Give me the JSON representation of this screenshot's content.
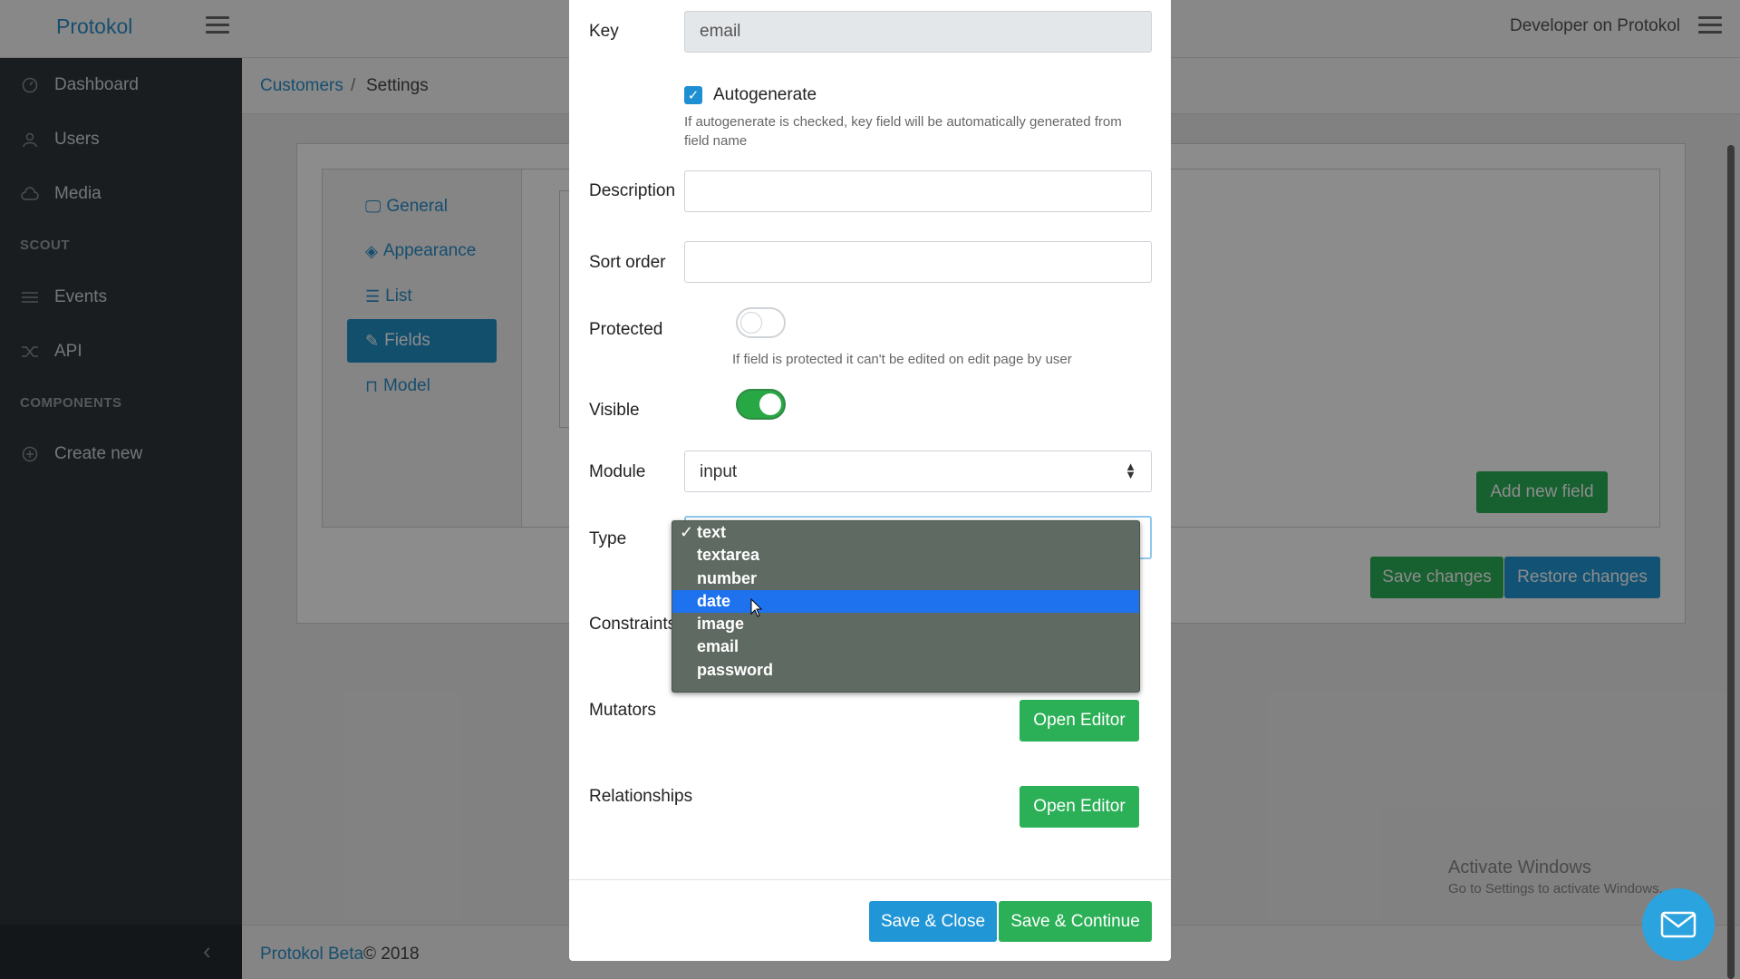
{
  "app": {
    "brand": "Protokol",
    "user": "Developer on Protokol"
  },
  "sidebar": {
    "items": [
      {
        "label": "Dashboard",
        "icon": "speedometer-icon"
      },
      {
        "label": "Users",
        "icon": "user-icon"
      },
      {
        "label": "Media",
        "icon": "cloud-icon"
      }
    ],
    "section_scout": "SCOUT",
    "scout_items": [
      {
        "label": "Events",
        "icon": "list-icon"
      },
      {
        "label": "API",
        "icon": "shuffle-icon"
      }
    ],
    "section_components": "COMPONENTS",
    "components_items": [
      {
        "label": "Create new",
        "icon": "plus-circle-icon"
      }
    ]
  },
  "breadcrumb": {
    "link": "Customers",
    "separator": "/",
    "current": "Settings"
  },
  "settings_tabs": [
    {
      "label": "General",
      "icon": "monitor-icon"
    },
    {
      "label": "Appearance",
      "icon": "layers-icon"
    },
    {
      "label": "List",
      "icon": "list-icon"
    },
    {
      "label": "Fields",
      "icon": "pencil-icon",
      "active": true
    },
    {
      "label": "Model",
      "icon": "model-icon"
    }
  ],
  "page_buttons": {
    "add_new_field": "Add new field",
    "save_changes": "Save changes",
    "restore_changes": "Restore changes"
  },
  "footer": {
    "link": "Protokol Beta",
    "copyright": "© 2018"
  },
  "watermark": {
    "line1": "Activate Windows",
    "line2": "Go to Settings to activate Windows."
  },
  "modal": {
    "key": {
      "label": "Key",
      "value": "email"
    },
    "autogenerate": {
      "label": "Autogenerate",
      "checked": true,
      "help": "If autogenerate is checked, key field will be automatically generated from field name"
    },
    "description": {
      "label": "Description",
      "value": ""
    },
    "sort_order": {
      "label": "Sort order",
      "value": ""
    },
    "protected": {
      "label": "Protected",
      "on": false,
      "help": "If field is protected it can't be edited on edit page by user"
    },
    "visible": {
      "label": "Visible",
      "on": true
    },
    "module": {
      "label": "Module",
      "value": "input"
    },
    "type": {
      "label": "Type",
      "options": [
        "text",
        "textarea",
        "number",
        "date",
        "image",
        "email",
        "password"
      ],
      "checked": "text",
      "highlighted": "date"
    },
    "constraints": {
      "label": "Constraints"
    },
    "mutators": {
      "label": "Mutators",
      "button": "Open Editor"
    },
    "relationships": {
      "label": "Relationships",
      "button": "Open Editor"
    },
    "save_close": "Save & Close",
    "save_continue": "Save & Continue"
  },
  "colors": {
    "brand_blue": "#2a8fc9",
    "green": "#2bb057",
    "blue_button": "#2196d6",
    "dropdown_highlight": "#1f72ee"
  }
}
